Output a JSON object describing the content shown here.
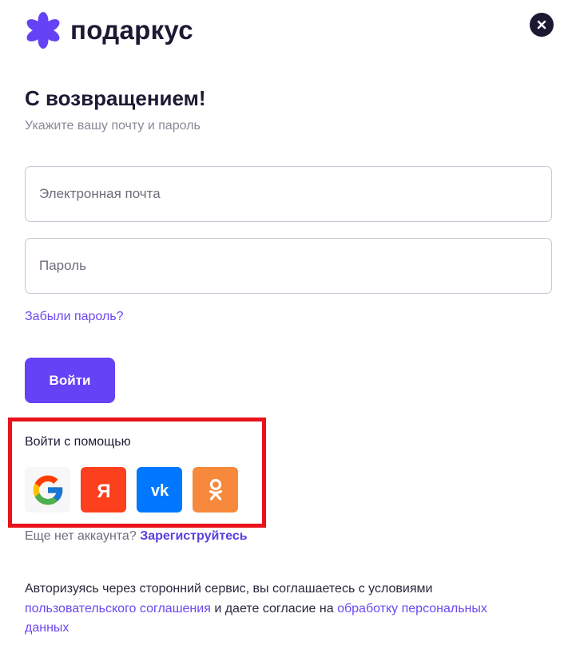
{
  "brand": {
    "name": "подаркус",
    "color": "#6542f5"
  },
  "header": {
    "close_label": "Закрыть"
  },
  "login": {
    "title": "С возвращением!",
    "subtitle": "Укажите вашу почту и пароль",
    "email_placeholder": "Электронная почта",
    "password_placeholder": "Пароль",
    "forgot_link": "Забыли пароль?",
    "submit_label": "Войти"
  },
  "social": {
    "title": "Войти с помощью",
    "providers": [
      {
        "icon": "google-icon",
        "color": "#f7f7f9"
      },
      {
        "icon": "yandex-icon",
        "label": "Я",
        "color": "#fc3f1d"
      },
      {
        "icon": "vk-icon",
        "label": "vk",
        "color": "#0077ff"
      },
      {
        "icon": "odnoklassniki-icon",
        "color": "#f7893c"
      }
    ]
  },
  "signup": {
    "text": "Еще нет аккаунта?",
    "link": "Зарегиструйтесь"
  },
  "terms": {
    "text_1": "Авторизуясь через сторонний сервис, вы соглашаетесь с условиями",
    "link_1": "пользовательского соглашения",
    "text_2": "и даете согласие на",
    "link_2": "обработку персональных данных"
  },
  "colors": {
    "accent": "#6542f5",
    "link": "#6b48f2",
    "highlight": "#e8131b",
    "text": "#1c1a33"
  }
}
